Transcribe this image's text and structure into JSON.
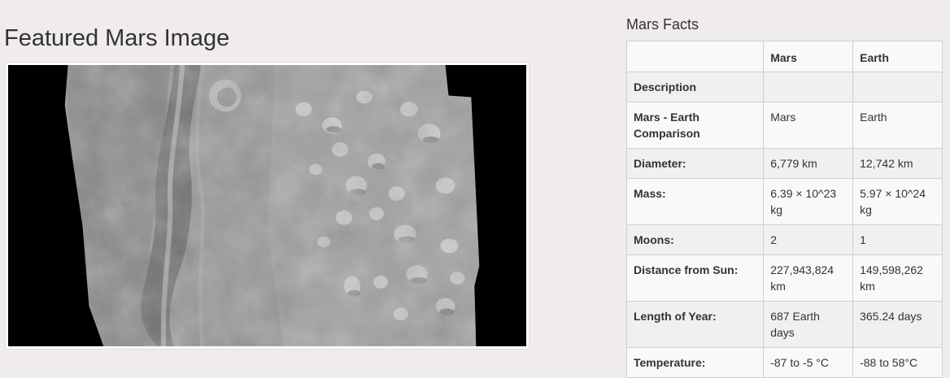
{
  "featured": {
    "title": "Featured Mars Image",
    "image_alt": "Grayscale orbital image of Martian terrain with channel and mesas"
  },
  "facts": {
    "title": "Mars Facts",
    "headers": [
      "",
      "Mars",
      "Earth"
    ],
    "rows": [
      {
        "label": "Description",
        "mars": "",
        "earth": ""
      },
      {
        "label": "Mars - Earth Comparison",
        "mars": "Mars",
        "earth": "Earth"
      },
      {
        "label": "Diameter:",
        "mars": "6,779 km",
        "earth": "12,742 km"
      },
      {
        "label": "Mass:",
        "mars": "6.39 × 10^23 kg",
        "earth": "5.97 × 10^24 kg"
      },
      {
        "label": "Moons:",
        "mars": "2",
        "earth": "1"
      },
      {
        "label": "Distance from Sun:",
        "mars": "227,943,824 km",
        "earth": "149,598,262 km"
      },
      {
        "label": "Length of Year:",
        "mars": "687 Earth days",
        "earth": "365.24 days"
      },
      {
        "label": "Temperature:",
        "mars": "-87 to -5 °C",
        "earth": "-88 to 58°C"
      }
    ]
  },
  "colors": {
    "background": "#efeceb",
    "text": "#333333",
    "table_border": "#cfcfcf",
    "row_shade": "#f1f0f0",
    "row_light": "#f9f9f9"
  }
}
